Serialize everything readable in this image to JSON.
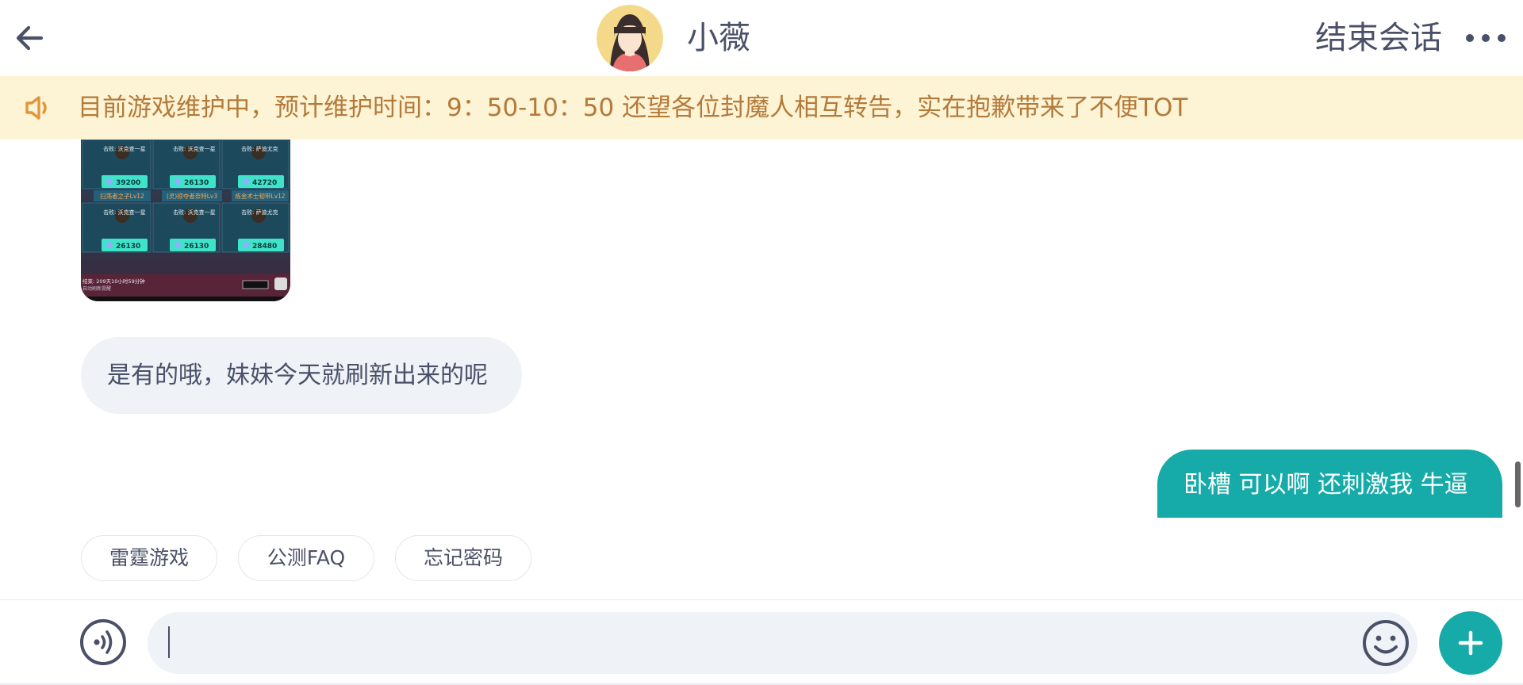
{
  "header": {
    "agent_name": "小薇",
    "end_session_label": "结束会话"
  },
  "notice": {
    "text": "目前游戏维护中，预计维护时间：9：50-10：50 还望各位封魔人相互转告，实在抱歉带来了不便TOT"
  },
  "messages": {
    "agent_reply": "是有的哦，妹妹今天就刷新出来的呢",
    "user_message": "卧槽 可以啊 还刺激我 牛逼"
  },
  "shop_screenshot": {
    "items": [
      {
        "caption": "击败: 沃克查一星",
        "price": "39200"
      },
      {
        "caption": "击败: 沃克查一星",
        "price": "26130"
      },
      {
        "caption": "击败: 萨迪尤克",
        "price": "42720"
      },
      {
        "caption": "击败: 沃克查一星",
        "price": "26130"
      },
      {
        "caption": "击败: 沃克查一星",
        "price": "26130"
      },
      {
        "caption": "击败: 萨迪尤克",
        "price": "28480"
      }
    ],
    "row_labels": [
      "扫荡者之子Lv12",
      "(灵)掠夺者奈特Lv3",
      "炼金术士韧带Lv12"
    ],
    "footer": "结束: 209天10小时59分钟",
    "footer_sub": "自动刷新提醒"
  },
  "quick_replies": [
    "雷霆游戏",
    "公测FAQ",
    "忘记密码"
  ],
  "input": {
    "placeholder": ""
  },
  "colors": {
    "accent": "#16aba8",
    "notice_bg": "#fdf4d6",
    "notice_text": "#b47a3a",
    "bubble_left_bg": "#eff2f6"
  },
  "icons": {
    "back": "arrow-left-icon",
    "more": "more-dots-icon",
    "notice": "speaker-icon",
    "voice": "voice-icon",
    "emoji": "emoji-icon",
    "plus": "plus-icon"
  }
}
